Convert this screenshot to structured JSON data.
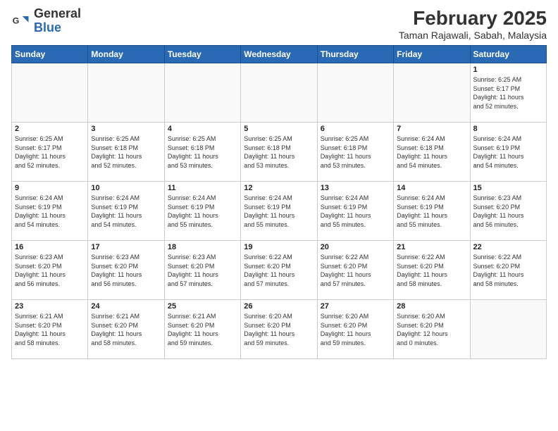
{
  "header": {
    "logo_general": "General",
    "logo_blue": "Blue",
    "month_year": "February 2025",
    "location": "Taman Rajawali, Sabah, Malaysia"
  },
  "weekdays": [
    "Sunday",
    "Monday",
    "Tuesday",
    "Wednesday",
    "Thursday",
    "Friday",
    "Saturday"
  ],
  "weeks": [
    [
      {
        "day": "",
        "info": ""
      },
      {
        "day": "",
        "info": ""
      },
      {
        "day": "",
        "info": ""
      },
      {
        "day": "",
        "info": ""
      },
      {
        "day": "",
        "info": ""
      },
      {
        "day": "",
        "info": ""
      },
      {
        "day": "1",
        "info": "Sunrise: 6:25 AM\nSunset: 6:17 PM\nDaylight: 11 hours\nand 52 minutes."
      }
    ],
    [
      {
        "day": "2",
        "info": "Sunrise: 6:25 AM\nSunset: 6:17 PM\nDaylight: 11 hours\nand 52 minutes."
      },
      {
        "day": "3",
        "info": "Sunrise: 6:25 AM\nSunset: 6:18 PM\nDaylight: 11 hours\nand 52 minutes."
      },
      {
        "day": "4",
        "info": "Sunrise: 6:25 AM\nSunset: 6:18 PM\nDaylight: 11 hours\nand 53 minutes."
      },
      {
        "day": "5",
        "info": "Sunrise: 6:25 AM\nSunset: 6:18 PM\nDaylight: 11 hours\nand 53 minutes."
      },
      {
        "day": "6",
        "info": "Sunrise: 6:25 AM\nSunset: 6:18 PM\nDaylight: 11 hours\nand 53 minutes."
      },
      {
        "day": "7",
        "info": "Sunrise: 6:24 AM\nSunset: 6:18 PM\nDaylight: 11 hours\nand 54 minutes."
      },
      {
        "day": "8",
        "info": "Sunrise: 6:24 AM\nSunset: 6:19 PM\nDaylight: 11 hours\nand 54 minutes."
      }
    ],
    [
      {
        "day": "9",
        "info": "Sunrise: 6:24 AM\nSunset: 6:19 PM\nDaylight: 11 hours\nand 54 minutes."
      },
      {
        "day": "10",
        "info": "Sunrise: 6:24 AM\nSunset: 6:19 PM\nDaylight: 11 hours\nand 54 minutes."
      },
      {
        "day": "11",
        "info": "Sunrise: 6:24 AM\nSunset: 6:19 PM\nDaylight: 11 hours\nand 55 minutes."
      },
      {
        "day": "12",
        "info": "Sunrise: 6:24 AM\nSunset: 6:19 PM\nDaylight: 11 hours\nand 55 minutes."
      },
      {
        "day": "13",
        "info": "Sunrise: 6:24 AM\nSunset: 6:19 PM\nDaylight: 11 hours\nand 55 minutes."
      },
      {
        "day": "14",
        "info": "Sunrise: 6:24 AM\nSunset: 6:19 PM\nDaylight: 11 hours\nand 55 minutes."
      },
      {
        "day": "15",
        "info": "Sunrise: 6:23 AM\nSunset: 6:20 PM\nDaylight: 11 hours\nand 56 minutes."
      }
    ],
    [
      {
        "day": "16",
        "info": "Sunrise: 6:23 AM\nSunset: 6:20 PM\nDaylight: 11 hours\nand 56 minutes."
      },
      {
        "day": "17",
        "info": "Sunrise: 6:23 AM\nSunset: 6:20 PM\nDaylight: 11 hours\nand 56 minutes."
      },
      {
        "day": "18",
        "info": "Sunrise: 6:23 AM\nSunset: 6:20 PM\nDaylight: 11 hours\nand 57 minutes."
      },
      {
        "day": "19",
        "info": "Sunrise: 6:22 AM\nSunset: 6:20 PM\nDaylight: 11 hours\nand 57 minutes."
      },
      {
        "day": "20",
        "info": "Sunrise: 6:22 AM\nSunset: 6:20 PM\nDaylight: 11 hours\nand 57 minutes."
      },
      {
        "day": "21",
        "info": "Sunrise: 6:22 AM\nSunset: 6:20 PM\nDaylight: 11 hours\nand 58 minutes."
      },
      {
        "day": "22",
        "info": "Sunrise: 6:22 AM\nSunset: 6:20 PM\nDaylight: 11 hours\nand 58 minutes."
      }
    ],
    [
      {
        "day": "23",
        "info": "Sunrise: 6:21 AM\nSunset: 6:20 PM\nDaylight: 11 hours\nand 58 minutes."
      },
      {
        "day": "24",
        "info": "Sunrise: 6:21 AM\nSunset: 6:20 PM\nDaylight: 11 hours\nand 58 minutes."
      },
      {
        "day": "25",
        "info": "Sunrise: 6:21 AM\nSunset: 6:20 PM\nDaylight: 11 hours\nand 59 minutes."
      },
      {
        "day": "26",
        "info": "Sunrise: 6:20 AM\nSunset: 6:20 PM\nDaylight: 11 hours\nand 59 minutes."
      },
      {
        "day": "27",
        "info": "Sunrise: 6:20 AM\nSunset: 6:20 PM\nDaylight: 11 hours\nand 59 minutes."
      },
      {
        "day": "28",
        "info": "Sunrise: 6:20 AM\nSunset: 6:20 PM\nDaylight: 12 hours\nand 0 minutes."
      },
      {
        "day": "",
        "info": ""
      }
    ]
  ]
}
